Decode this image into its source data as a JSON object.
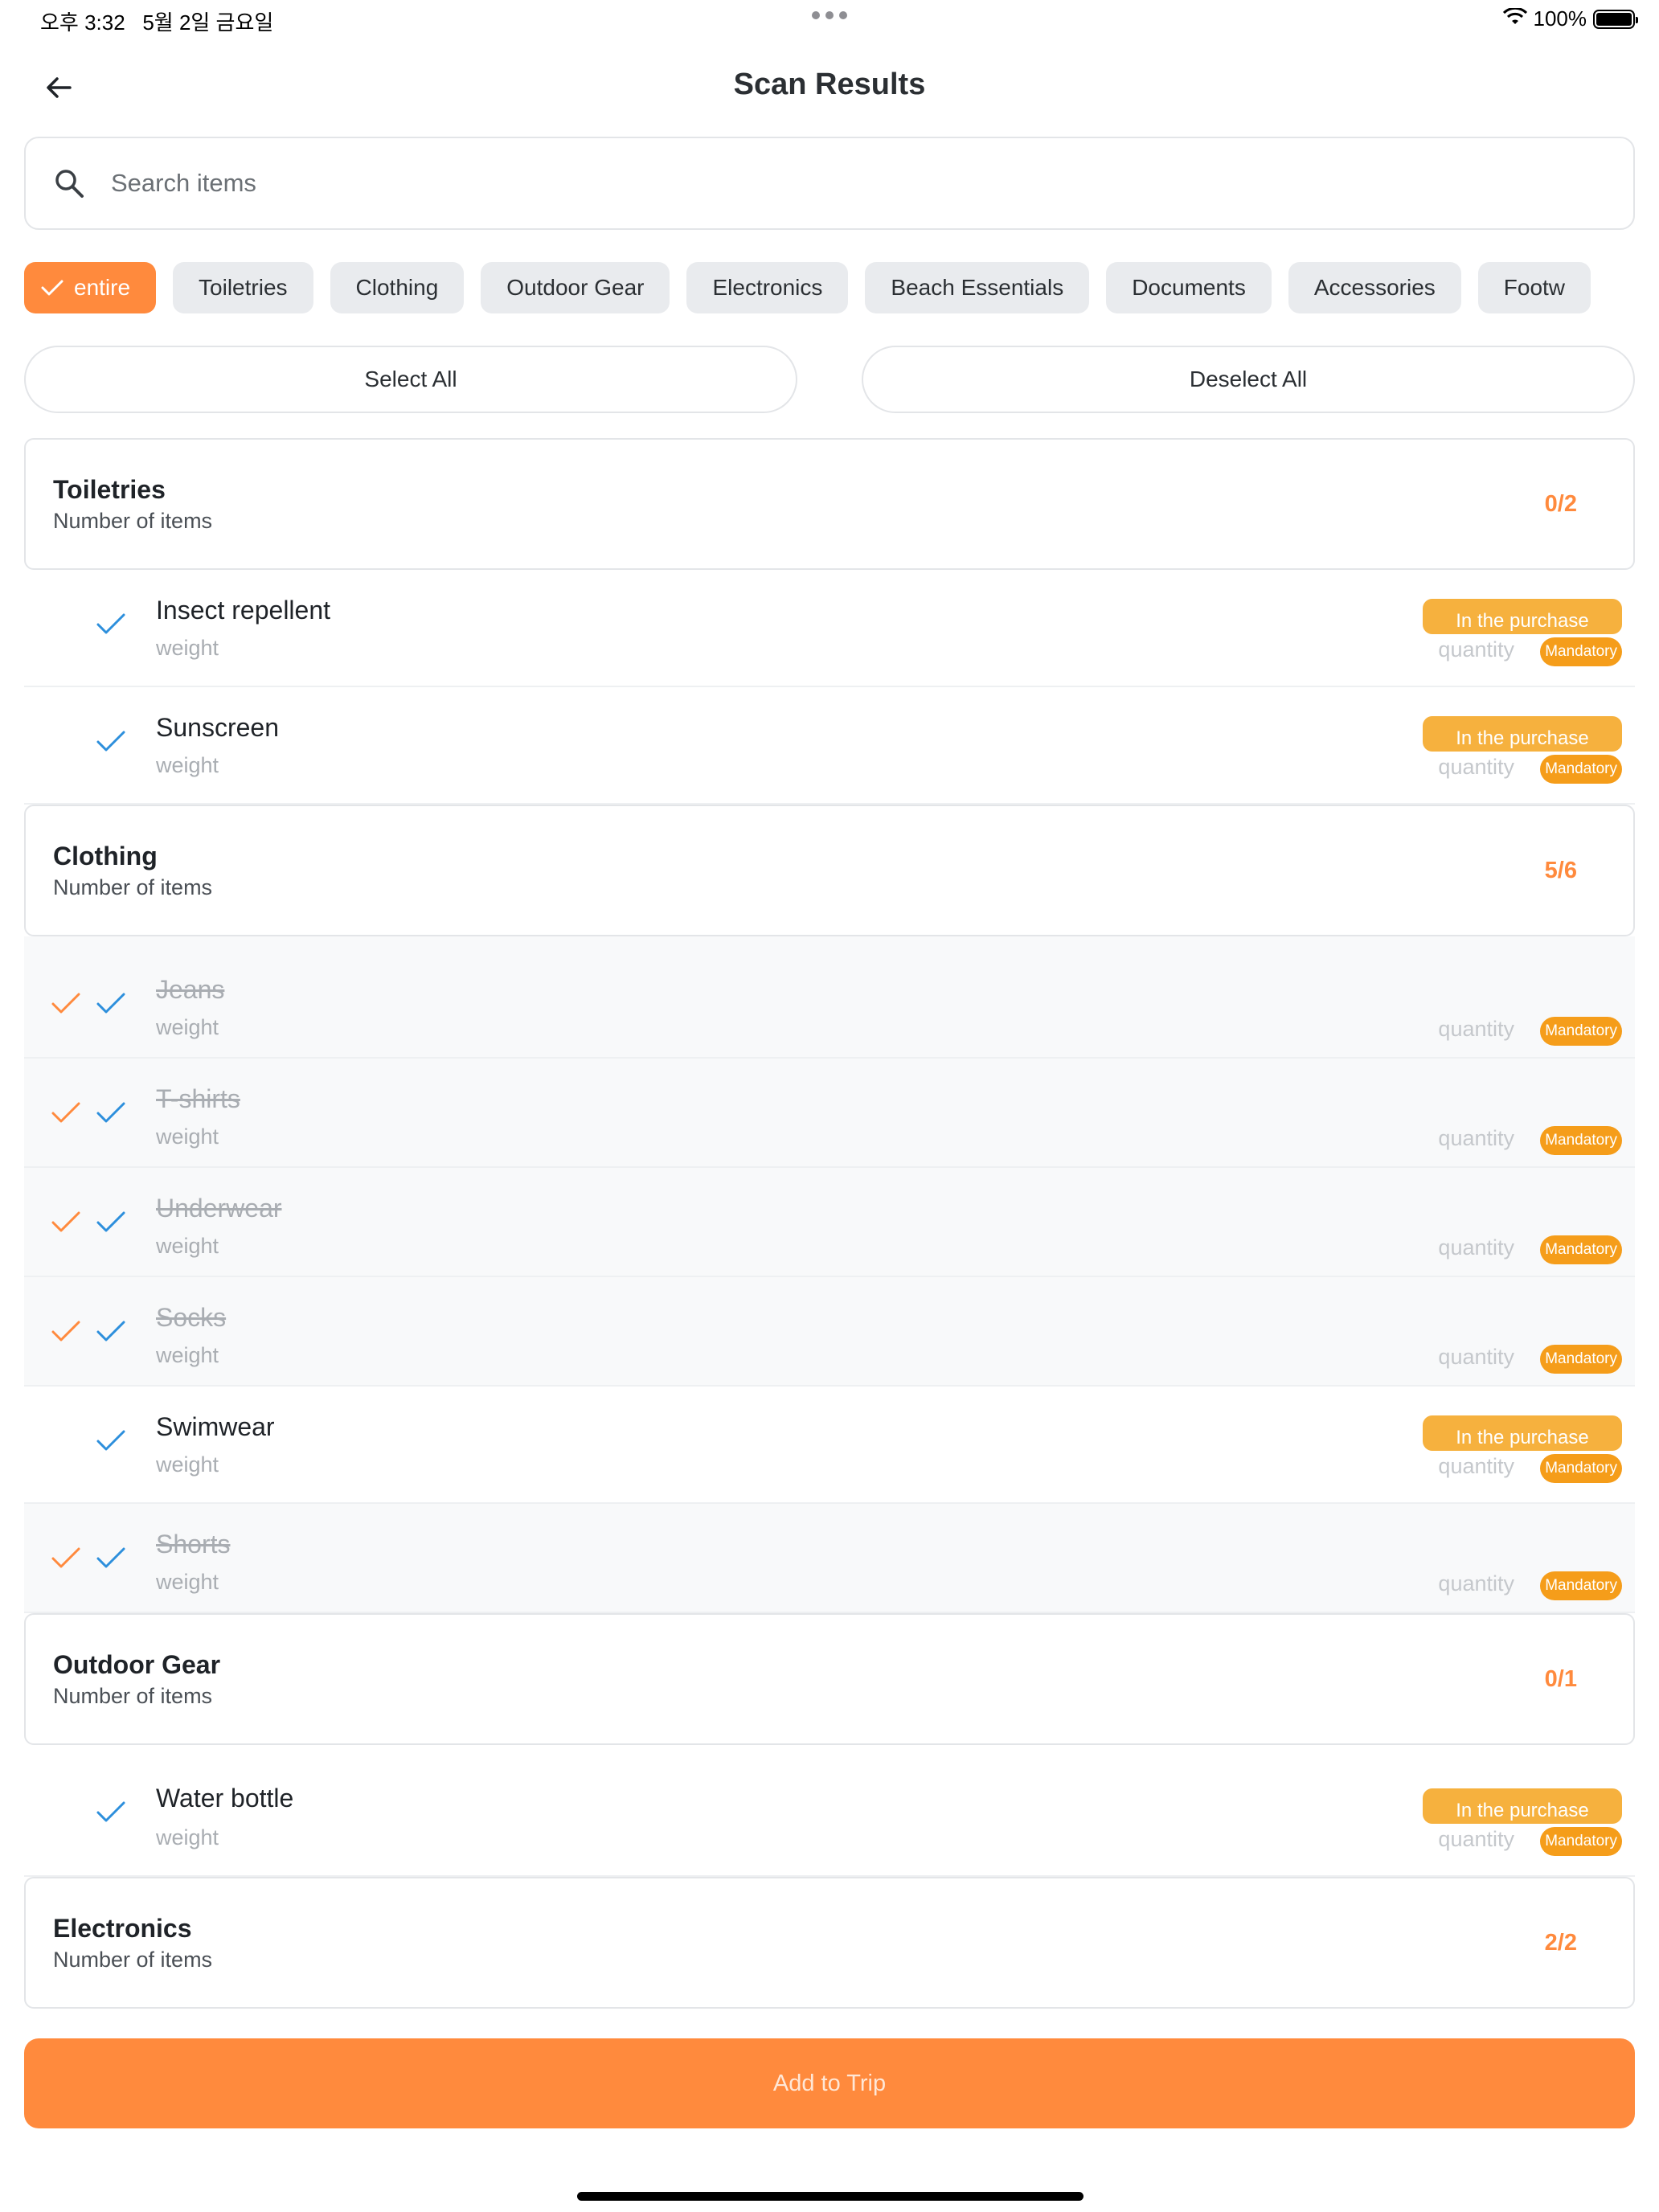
{
  "status": {
    "time": "오후 3:32",
    "date": "5월 2일 금요일",
    "battery": "100%"
  },
  "header": {
    "title": "Scan Results"
  },
  "search": {
    "placeholder": "Search items"
  },
  "chips": [
    "entire",
    "Toiletries",
    "Clothing",
    "Outdoor Gear",
    "Electronics",
    "Beach Essentials",
    "Documents",
    "Accessories",
    "Footw"
  ],
  "actions": {
    "select_all": "Select All",
    "deselect_all": "Deselect All",
    "add_to_trip": "Add to Trip"
  },
  "item_labels": {
    "weight": "weight",
    "quantity": "quantity",
    "mandatory": "Mandatory",
    "purchase": "In the purchase"
  },
  "categories": [
    {
      "name": "Toiletries",
      "subtitle": "Number of items",
      "count": "0/2",
      "items": [
        {
          "name": "Insect repellent",
          "packed": false
        },
        {
          "name": "Sunscreen",
          "packed": false
        }
      ]
    },
    {
      "name": "Clothing",
      "subtitle": "Number of items",
      "count": "5/6",
      "items": [
        {
          "name": "Jeans",
          "packed": true
        },
        {
          "name": "T-shirts",
          "packed": true
        },
        {
          "name": "Underwear",
          "packed": true
        },
        {
          "name": "Socks",
          "packed": true
        },
        {
          "name": "Swimwear",
          "packed": false
        },
        {
          "name": "Shorts",
          "packed": true
        }
      ]
    },
    {
      "name": "Outdoor Gear",
      "subtitle": "Number of items",
      "count": "0/1",
      "items": [
        {
          "name": "Water bottle",
          "packed": false
        }
      ]
    },
    {
      "name": "Electronics",
      "subtitle": "Number of items",
      "count": "2/2",
      "items": []
    }
  ],
  "colors": {
    "accent": "#ff8a3d",
    "check_blue": "#2d8fdc",
    "purchase_badge": "#f6b13e",
    "mandatory_badge": "#f59d1a"
  },
  "icons": {
    "back": "arrow-left-icon",
    "search": "search-icon",
    "check": "check-icon",
    "wifi": "wifi-icon",
    "battery": "battery-icon"
  }
}
